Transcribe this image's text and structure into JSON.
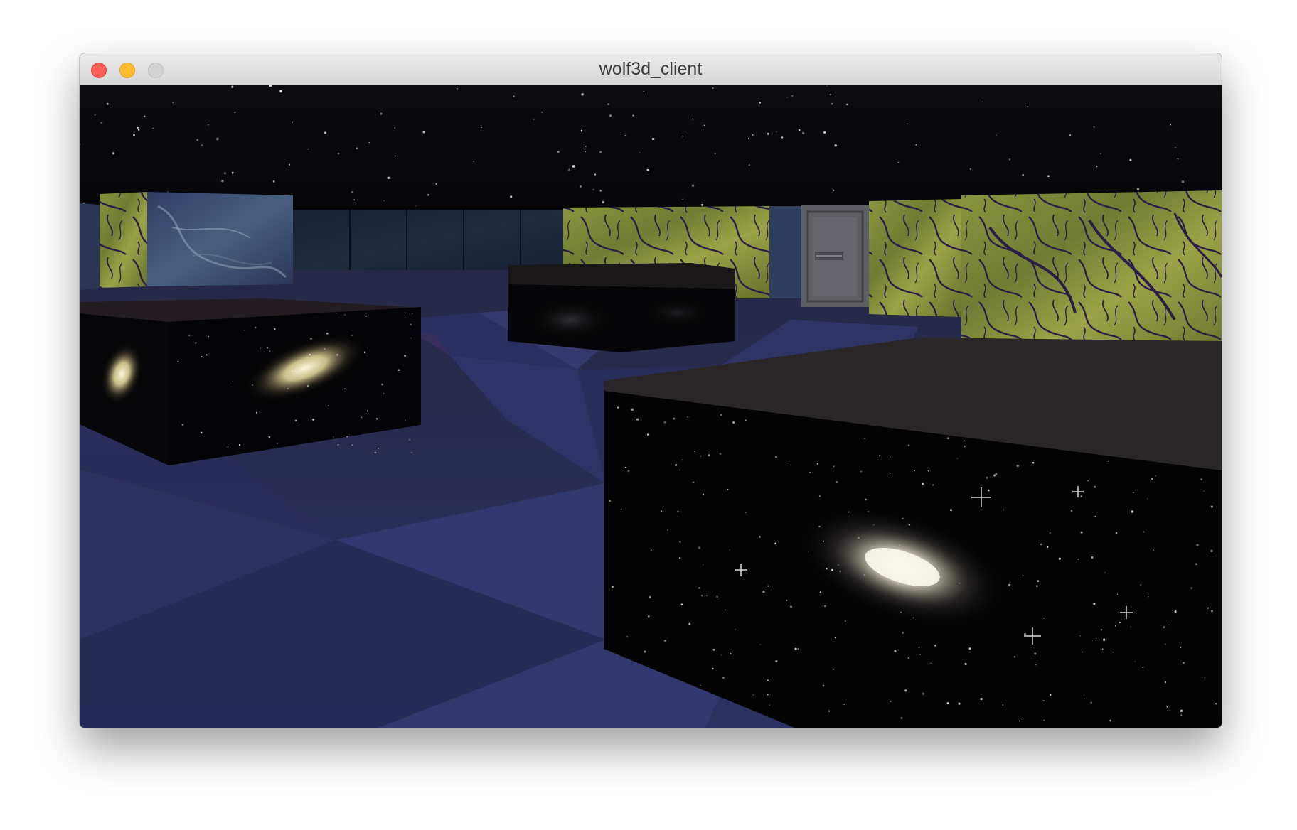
{
  "window": {
    "title": "wolf3d_client",
    "buttons": {
      "close": "close",
      "minimize": "minimize",
      "zoom": "zoom"
    }
  },
  "scene": {
    "colors": {
      "sky": "#050508",
      "floor_light": "#34396e",
      "floor_dark": "#282b55",
      "block_top": "#2a2628",
      "galaxy_glow": "#f3eec6",
      "moss_wall": "#7d8a3a",
      "earth_wall": "#3e5477",
      "door": "#55585c"
    },
    "objects": [
      "starfield-sky",
      "checkered-floor",
      "earth-texture-wall",
      "moss-texture-wall",
      "metal-door",
      "galaxy-block-left",
      "galaxy-block-center",
      "galaxy-block-right"
    ]
  }
}
